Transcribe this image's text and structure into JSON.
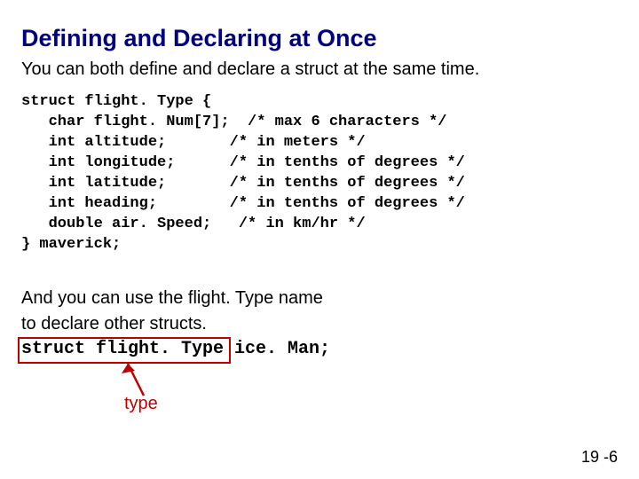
{
  "title": "Defining and Declaring at Once",
  "subtitle": "You can both define and declare a struct at the same time.",
  "code": {
    "l1": "struct flight. Type {",
    "l2": "   char flight. Num[7];  /* max 6 characters */",
    "l3": "   int altitude;       /* in meters */",
    "l4": "   int longitude;      /* in tenths of degrees */",
    "l5": "   int latitude;       /* in tenths of degrees */",
    "l6": "   int heading;        /* in tenths of degrees */",
    "l7": "   double air. Speed;   /* in km/hr */",
    "l8": "} maverick;"
  },
  "para1": "And you can use the flight. Type name",
  "para2": "to declare other structs.",
  "decl": "struct flight. Type ice. Man;",
  "type_label": "type",
  "page_number": "19 -6"
}
